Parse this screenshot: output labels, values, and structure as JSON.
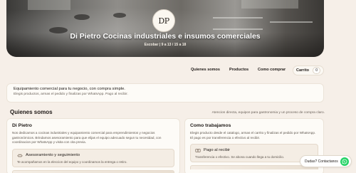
{
  "hero": {
    "logo_text": "DP",
    "title": "Di Pietro Cocinas industriales e insumos comerciales",
    "subtitle": "Escobar | 9 a 13 / 15 a 18"
  },
  "nav": {
    "links": [
      "Quienes somos",
      "Productos",
      "Como comprar"
    ],
    "cart_label": "Carrito",
    "cart_count": "0"
  },
  "promo": {
    "title": "Equipamiento comercial para tu negocio, con compra simple.",
    "subtitle": "Elegis productos, armas el pedido y finalizas por WhatsApp. Pago al recibir."
  },
  "about": {
    "section_title": "Quienes somos",
    "section_note": "Atencion directa, equipos para gastronomia y un proceso de compra claro.",
    "cards": [
      {
        "title": "Di Pietro",
        "text": "Nos dedicamos a cocinas industriales y equipamiento comercial para emprendimientos y negocios gastronómicos. Brindamos asesoramiento para que elijas el equipo adecuado segun tu necesidad, con coordinacion por WhatsApp y visita con cita previa.",
        "feature_title": "Asesoramiento y seguimiento",
        "feature_text": "Te acompañamos en la eleccion del equipo y coordinamos la entrega o retiro."
      },
      {
        "title": "Como trabajamos",
        "text": "Elegis producto desde el catalogo, armas el carrito y finalizas el pedido por WhatsApp. El pago es por transferencia o efectivo al recibir.",
        "feature_title": "Pago al recibir",
        "feature_text": "Transferencia o efectivo. Se abona cuando llega a tu domicilio."
      }
    ]
  },
  "whatsapp": {
    "label": "Dudas? Contactanos"
  },
  "colors": {
    "background": "#f6efe8",
    "whatsapp_green": "#25d366"
  }
}
